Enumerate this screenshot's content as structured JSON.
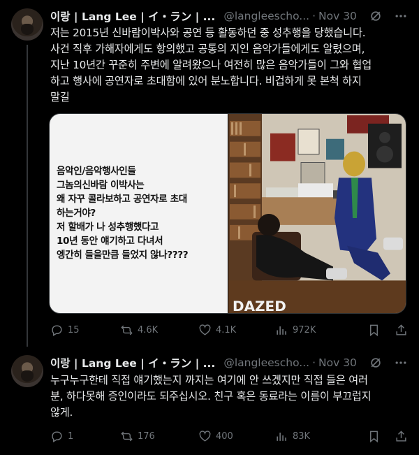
{
  "tweets": [
    {
      "name": "이랑 | Lang Lee | イ・ラン | ...",
      "handle": "@langleescho...",
      "time": "Nov 30",
      "lines": [
        "저는 2015년 신바람이박사와 공연 등 활동하던 중 성추행을 당했습니다.",
        "사건 직후 가해자에게도 항의했고 공통의 지인 음악가들에게도 알렸으며,",
        "지난 10년간 꾸준히 주변에 알려왔으나 여전히 많은 음악가들이 그와 협업",
        "하고 행사에 공연자로 초대함에 있어 분노합니다. 비겁하게 못 본척 하지",
        "말길"
      ],
      "image_note": [
        "음악인/음악행사인들",
        "그놈의신바람 이박사는",
        "왜 자꾸 콜라보하고 공연자로 초대",
        "하는거야?",
        "저 할배가 나 성추행했다고",
        "10년 동안 얘기하고 다녀서",
        "엥간히 들을만큼 들었지 않나????"
      ],
      "photo_caption": "DAZED",
      "stats": {
        "replies": "15",
        "reposts": "4.6K",
        "likes": "4.1K",
        "views": "972K"
      }
    },
    {
      "name": "이랑 | Lang Lee | イ・ラン | ...",
      "handle": "@langleescho...",
      "time": "Nov 30",
      "lines": [
        "누구누구한테 직접 얘기했는지 까지는 여기에 안 쓰겠지만 직접 들은 여러",
        "분, 하다못해 증인이라도 되주십시오. 친구 혹은 동료라는 이름이 부끄럽지",
        "않게."
      ],
      "stats": {
        "replies": "1",
        "reposts": "176",
        "likes": "400",
        "views": "83K"
      }
    }
  ],
  "icons": [
    "grok-icon",
    "more-icon",
    "reply-icon",
    "repost-icon",
    "like-icon",
    "views-icon",
    "bookmark-icon",
    "share-icon"
  ],
  "colors": {
    "background": "#000000",
    "text": "#e7e9ea",
    "muted": "#71767b",
    "divider": "#2f3336"
  }
}
